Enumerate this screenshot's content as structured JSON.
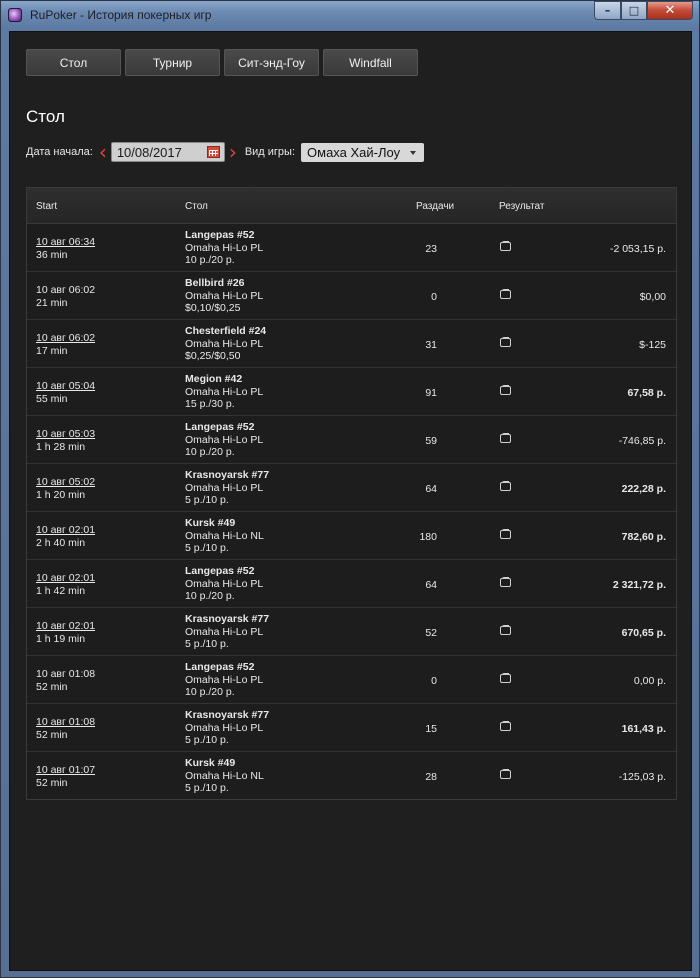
{
  "window": {
    "title": "RuPoker - История покерных игр",
    "controls": {
      "minimize": "–",
      "maximize": "□",
      "close": "✕"
    }
  },
  "tabs": [
    {
      "label": "Стол"
    },
    {
      "label": "Турнир"
    },
    {
      "label": "Сит-энд-Гоу"
    },
    {
      "label": "Windfall"
    }
  ],
  "page_title": "Стол",
  "filters": {
    "start_date_label": "Дата начала:",
    "start_date_value": "10/08/2017",
    "game_type_label": "Вид игры:",
    "game_type_value": "Омаха Хай-Лоу"
  },
  "table": {
    "headers": {
      "start": "Start",
      "table": "Стол",
      "hands": "Раздачи",
      "result": "Результат"
    },
    "rows": [
      {
        "start": "10 авг 06:34",
        "duration": "36 min",
        "name": "Langepas #52",
        "game": "Omaha Hi-Lo PL",
        "stakes": "10 р./20 р.",
        "hands": "23",
        "result": "-2 053,15 р.",
        "link": true,
        "bold": false
      },
      {
        "start": "10 авг 06:02",
        "duration": "21 min",
        "name": "Bellbird #26",
        "game": "Omaha Hi-Lo PL",
        "stakes": "$0,10/$0,25",
        "hands": "0",
        "result": "$0,00",
        "link": false,
        "bold": false
      },
      {
        "start": "10 авг 06:02",
        "duration": "17 min",
        "name": "Chesterfield #24",
        "game": "Omaha Hi-Lo PL",
        "stakes": "$0,25/$0,50",
        "hands": "31",
        "result": "$-125",
        "link": true,
        "bold": false
      },
      {
        "start": "10 авг 05:04",
        "duration": "55 min",
        "name": "Megion #42",
        "game": "Omaha Hi-Lo PL",
        "stakes": "15 р./30 р.",
        "hands": "91",
        "result": "67,58 р.",
        "link": true,
        "bold": true
      },
      {
        "start": "10 авг 05:03",
        "duration": "1 h 28 min",
        "name": "Langepas #52",
        "game": "Omaha Hi-Lo PL",
        "stakes": "10 р./20 р.",
        "hands": "59",
        "result": "-746,85 р.",
        "link": true,
        "bold": false
      },
      {
        "start": "10 авг 05:02",
        "duration": "1 h 20 min",
        "name": "Krasnoyarsk #77",
        "game": "Omaha Hi-Lo PL",
        "stakes": "5 р./10 р.",
        "hands": "64",
        "result": "222,28 р.",
        "link": true,
        "bold": true
      },
      {
        "start": "10 авг 02:01",
        "duration": "2 h 40 min",
        "name": "Kursk #49",
        "game": "Omaha Hi-Lo NL",
        "stakes": "5 р./10 р.",
        "hands": "180",
        "result": "782,60 р.",
        "link": true,
        "bold": true
      },
      {
        "start": "10 авг 02:01",
        "duration": "1 h 42 min",
        "name": "Langepas #52",
        "game": "Omaha Hi-Lo PL",
        "stakes": "10 р./20 р.",
        "hands": "64",
        "result": "2 321,72 р.",
        "link": true,
        "bold": true
      },
      {
        "start": "10 авг 02:01",
        "duration": "1 h 19 min",
        "name": "Krasnoyarsk #77",
        "game": "Omaha Hi-Lo PL",
        "stakes": "5 р./10 р.",
        "hands": "52",
        "result": "670,65 р.",
        "link": true,
        "bold": true
      },
      {
        "start": "10 авг 01:08",
        "duration": "52 min",
        "name": "Langepas #52",
        "game": "Omaha Hi-Lo PL",
        "stakes": "10 р./20 р.",
        "hands": "0",
        "result": "0,00 р.",
        "link": false,
        "bold": false
      },
      {
        "start": "10 авг 01:08",
        "duration": "52 min",
        "name": "Krasnoyarsk #77",
        "game": "Omaha Hi-Lo PL",
        "stakes": "5 р./10 р.",
        "hands": "15",
        "result": "161,43 р.",
        "link": true,
        "bold": true
      },
      {
        "start": "10 авг 01:07",
        "duration": "52 min",
        "name": "Kursk #49",
        "game": "Omaha Hi-Lo NL",
        "stakes": "5 р./10 р.",
        "hands": "28",
        "result": "-125,03 р.",
        "link": true,
        "bold": false
      }
    ]
  }
}
